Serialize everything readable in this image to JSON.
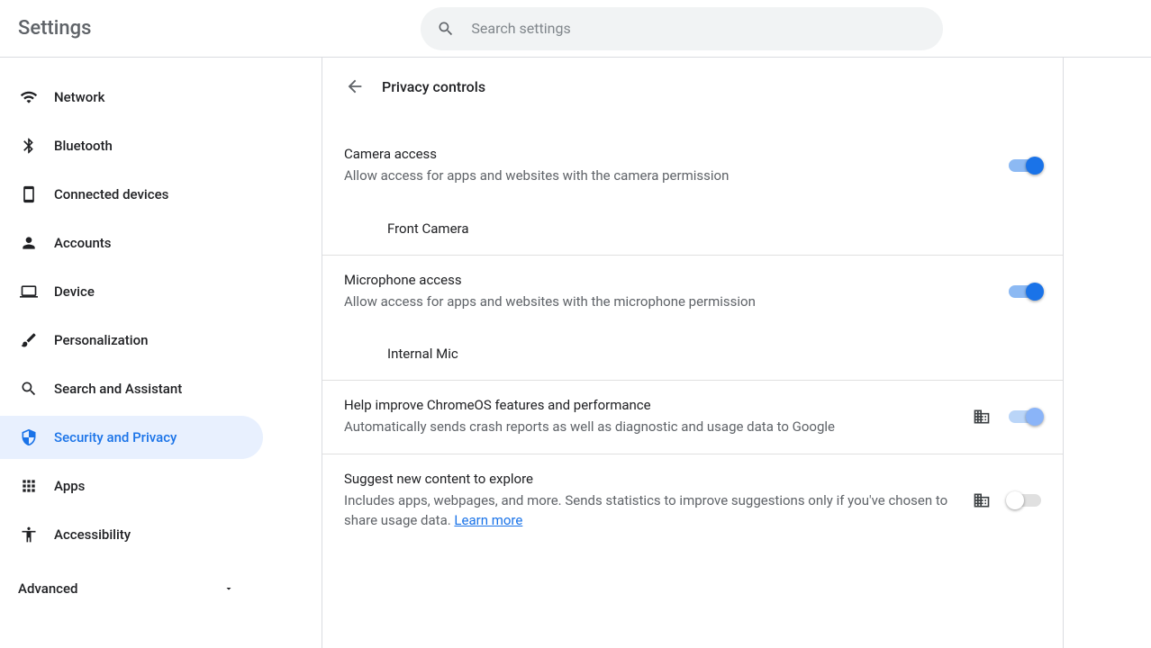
{
  "app_title": "Settings",
  "search": {
    "placeholder": "Search settings"
  },
  "sidebar": {
    "items": [
      {
        "label": "Network"
      },
      {
        "label": "Bluetooth"
      },
      {
        "label": "Connected devices"
      },
      {
        "label": "Accounts"
      },
      {
        "label": "Device"
      },
      {
        "label": "Personalization"
      },
      {
        "label": "Search and Assistant"
      },
      {
        "label": "Security and Privacy"
      },
      {
        "label": "Apps"
      },
      {
        "label": "Accessibility"
      }
    ],
    "advanced_label": "Advanced"
  },
  "page": {
    "title": "Privacy controls",
    "camera": {
      "title": "Camera access",
      "desc": "Allow access for apps and websites with the camera permission",
      "sub": "Front Camera"
    },
    "mic": {
      "title": "Microphone access",
      "desc": "Allow access for apps and websites with the microphone permission",
      "sub": "Internal Mic"
    },
    "improve": {
      "title": "Help improve ChromeOS features and performance",
      "desc": "Automatically sends crash reports as well as diagnostic and usage data to Google"
    },
    "suggest": {
      "title": "Suggest new content to explore",
      "desc": "Includes apps, webpages, and more. Sends statistics to improve suggestions only if you've chosen to share usage data. ",
      "link": "Learn more"
    }
  }
}
